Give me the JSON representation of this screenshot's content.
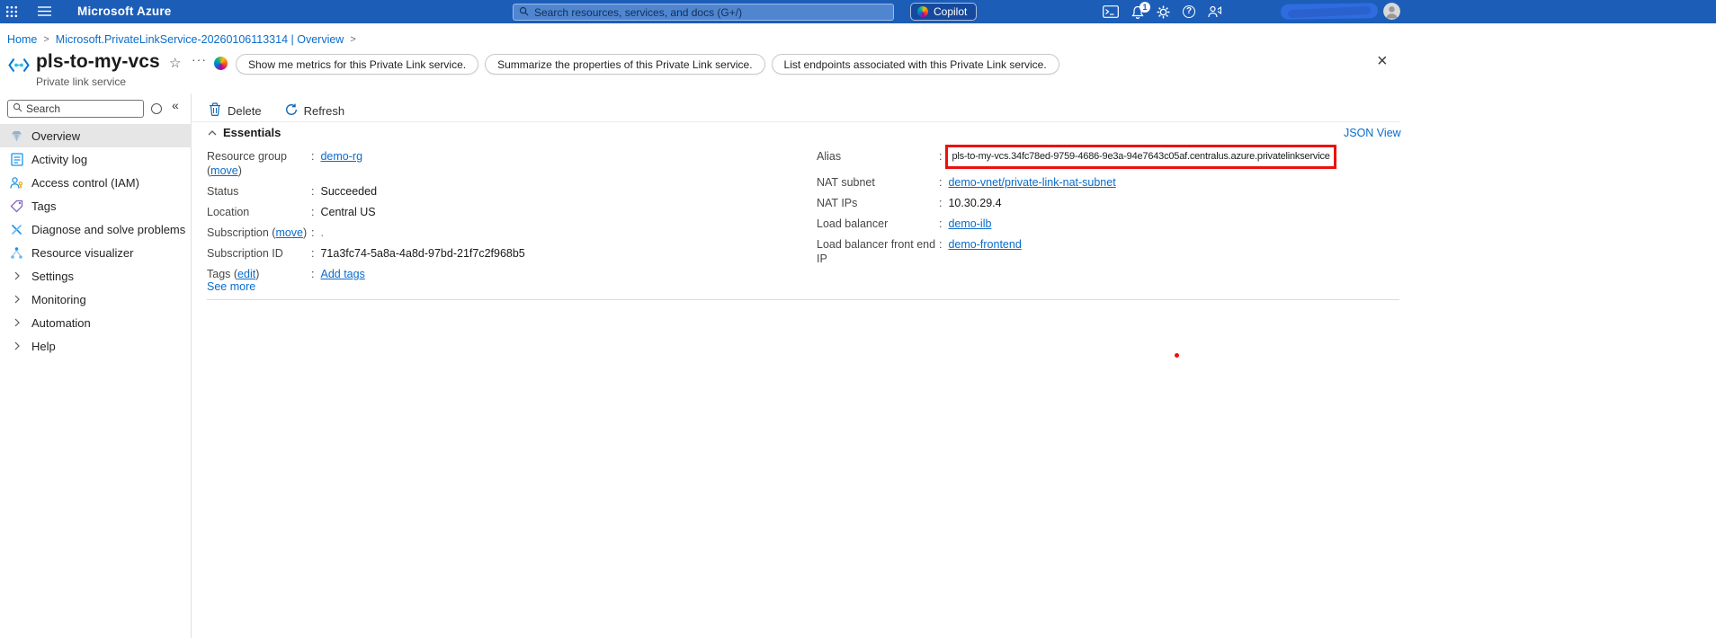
{
  "colors": {
    "accent": "#0a6ccb",
    "topbar_bg": "#1c5db8",
    "topbar_search_bg": "#4f86cf",
    "topbar_search_border": "#9cbce8",
    "copilot_btn_bg": "#16499b",
    "sidebar_selected_bg": "#e6e6e6",
    "highlight_red": "#ee0f0f",
    "text_primary": "#1c1c1c",
    "text_secondary": "#58585a"
  },
  "icons": {
    "help": "?",
    "star": "☆",
    "more": "···",
    "close": "×",
    "collapse": "«"
  },
  "topbar": {
    "brand": "Microsoft Azure",
    "search_placeholder": "Search resources, services, and docs (G+/)",
    "copilot_label": "Copilot",
    "notification_count": "1"
  },
  "breadcrumb": {
    "home": "Home",
    "current": "Microsoft.PrivateLinkService-20260106113314 | Overview",
    "separator": ">"
  },
  "page": {
    "title": "pls-to-my-vcs",
    "subtitle": "Private link service",
    "chips": [
      "Show me metrics for this Private Link service.",
      "Summarize the properties of this Private Link service.",
      "List endpoints associated with this Private Link service."
    ]
  },
  "sidebar": {
    "search_placeholder": "Search",
    "items": [
      {
        "label": "Overview"
      },
      {
        "label": "Activity log"
      },
      {
        "label": "Access control (IAM)"
      },
      {
        "label": "Tags"
      },
      {
        "label": "Diagnose and solve problems"
      },
      {
        "label": "Resource visualizer"
      },
      {
        "label": "Settings"
      },
      {
        "label": "Monitoring"
      },
      {
        "label": "Automation"
      },
      {
        "label": "Help"
      }
    ]
  },
  "commandbar": {
    "delete": "Delete",
    "refresh": "Refresh"
  },
  "essentials": {
    "title": "Essentials",
    "json_view": "JSON View",
    "see_more": "See more",
    "colon": ":",
    "fields": {
      "resource_group": {
        "label_prefix": "Resource group (",
        "label_link": "move",
        "label_suffix": ")",
        "value": "demo-rg"
      },
      "status": {
        "label": "Status",
        "value": "Succeeded"
      },
      "location": {
        "label": "Location",
        "value": "Central US"
      },
      "subscription": {
        "label_prefix": "Subscription (",
        "label_link": "move",
        "label_suffix": ")",
        "value": "."
      },
      "subscription_id": {
        "label": "Subscription ID",
        "value": "71a3fc74-5a8a-4a8d-97bd-21f7c2f968b5"
      },
      "tags": {
        "label_prefix": "Tags (",
        "label_link": "edit",
        "label_suffix": ")",
        "value": "Add tags"
      },
      "alias": {
        "label": "Alias",
        "value": "pls-to-my-vcs.34fc78ed-9759-4686-9e3a-94e7643c05af.centralus.azure.privatelinkservice"
      },
      "nat_subnet": {
        "label": "NAT subnet",
        "value": "demo-vnet/private-link-nat-subnet"
      },
      "nat_ips": {
        "label": "NAT IPs",
        "value": "10.30.29.4"
      },
      "load_balancer": {
        "label": "Load balancer",
        "value": "demo-ilb"
      },
      "lb_frontend": {
        "label": "Load balancer front end IP",
        "value": "demo-frontend"
      }
    }
  }
}
